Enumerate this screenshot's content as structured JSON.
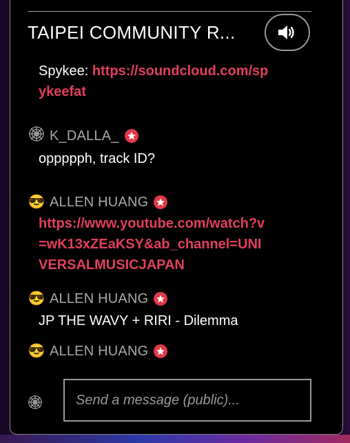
{
  "room": {
    "title": "TAIPEI COMMUNITY R..."
  },
  "messages": [
    {
      "prefix": "Spykee: ",
      "link": "https://soundcloud.com/spykeefat"
    },
    {
      "avatar": "cobweb-icon",
      "author": "K_DALLA_",
      "text": "oppppph, track ID?"
    },
    {
      "avatar": "sunglasses-emoji",
      "author": "ALLEN HUANG",
      "link": "https://www.youtube.com/watch?v=wK13xZEaKSY&ab_channel=UNIVERSALMUSICJAPAN"
    },
    {
      "avatar": "sunglasses-emoji",
      "author": "ALLEN HUANG",
      "text": "JP THE WAVY + RIRI - Dilemma"
    },
    {
      "avatar": "sunglasses-emoji",
      "author": "ALLEN HUANG"
    }
  ],
  "composer": {
    "placeholder": "Send a message (public)...",
    "icon": "cobweb-icon"
  },
  "colors": {
    "link": "#e0405a",
    "badge": "#e03a4a",
    "author": "#a8a8a8",
    "border": "#9a9a9a"
  }
}
